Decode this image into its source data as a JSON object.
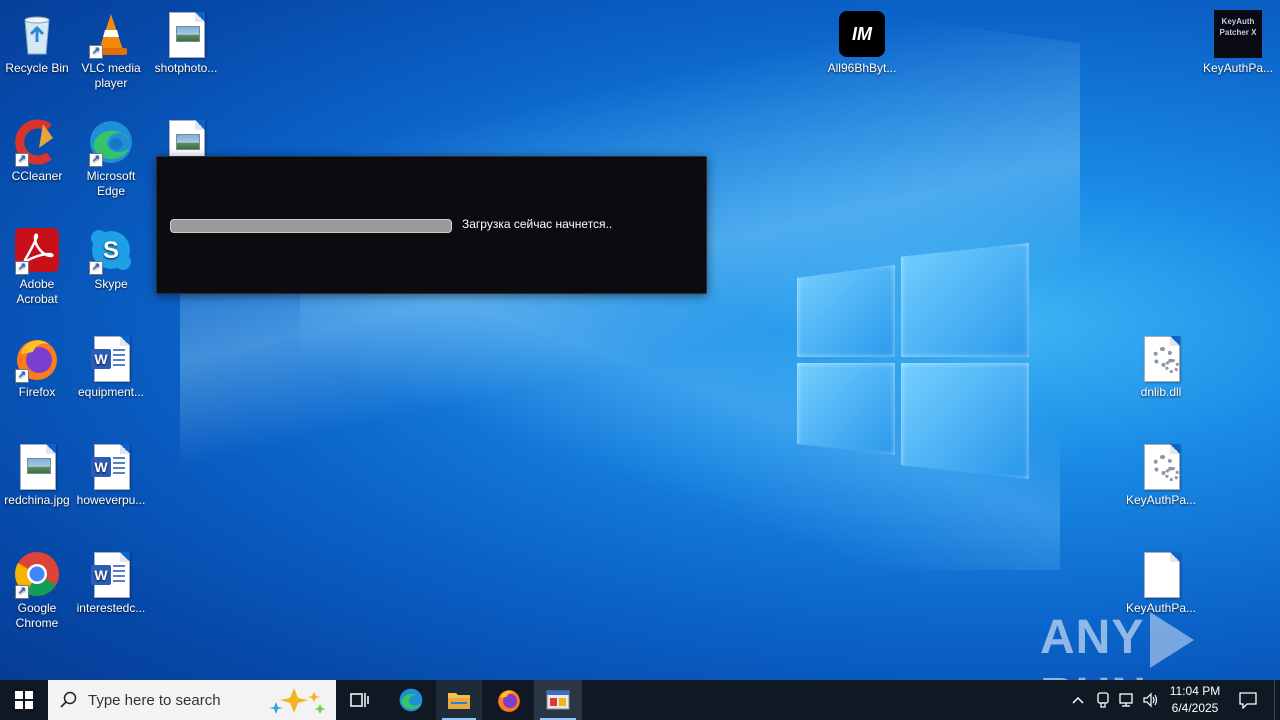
{
  "desktop": {
    "icons": [
      {
        "label": "Recycle Bin"
      },
      {
        "label": "VLC media player"
      },
      {
        "label": "shotphoto..."
      },
      {
        "label": "CCleaner"
      },
      {
        "label": "Microsoft Edge"
      },
      {
        "label": "Adobe Acrobat"
      },
      {
        "label": "Skype"
      },
      {
        "label": "Firefox"
      },
      {
        "label": "equipment..."
      },
      {
        "label": "redchina.jpg"
      },
      {
        "label": "howeverpu..."
      },
      {
        "label": "Google Chrome"
      },
      {
        "label": "interestedc..."
      },
      {
        "label": "All96BhByt..."
      },
      {
        "label": "KeyAuthPa..."
      },
      {
        "label": "dnlib.dll"
      },
      {
        "label": "KeyAuthPa..."
      },
      {
        "label": "KeyAuthPa..."
      }
    ],
    "keyauth_logo_text": "KeyAuth Patcher X",
    "all_logo_text": "IM"
  },
  "dialog": {
    "status_text": "Загрузка сейчас начнется..",
    "progress": 0
  },
  "watermark": {
    "left": "ANY",
    "right": "RUN"
  },
  "taskbar": {
    "search_placeholder": "Type here to search",
    "time": "11:04 PM",
    "date": "6/4/2025"
  },
  "colors": {
    "taskbar_bg": "#101923",
    "dialog_bg": "#0a0c10",
    "desktop_accent": "#0b63c9"
  }
}
